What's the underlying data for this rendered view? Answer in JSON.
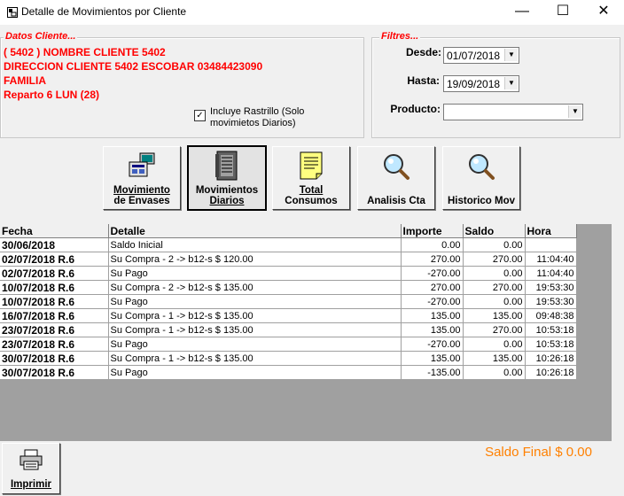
{
  "window": {
    "title": "Detalle de Movimientos por Cliente",
    "controls": {
      "minimize": "—",
      "maximize": "☐",
      "close": "✕"
    }
  },
  "client": {
    "legend": "Datos Cliente...",
    "lines": [
      "( 5402 ) NOMBRE CLIENTE 5402",
      "DIRECCION CLIENTE 5402 ESCOBAR 03484423090",
      "FAMILIA",
      "Reparto 6 LUN (28)"
    ],
    "checkbox_label": "Incluye Rastrillo (Solo movimietos Diarios)",
    "checkbox_checked": true
  },
  "filters": {
    "legend": "Filtres...",
    "desde_label": "Desde:",
    "desde_value": "01/07/2018",
    "hasta_label": "Hasta:",
    "hasta_value": "19/09/2018",
    "producto_label": "Producto:",
    "producto_value": ""
  },
  "toolbar": [
    {
      "line1": "Movimiento",
      "line2": "de Envases",
      "icon": "computer-icon"
    },
    {
      "line1": "Movimientos",
      "line2": "Diarios",
      "icon": "notebook-icon"
    },
    {
      "line1": "Total",
      "line2": "Consumos",
      "icon": "notepad-icon"
    },
    {
      "line1": "Analisis Cta",
      "line2": "",
      "icon": "magnifier-icon"
    },
    {
      "line1": "Historico Mov",
      "line2": "",
      "icon": "magnifier-icon"
    }
  ],
  "table": {
    "columns": [
      "Fecha",
      "Detalle",
      "Importe",
      "Saldo",
      "Hora"
    ],
    "rows": [
      [
        "30/06/2018",
        "Saldo Inicial",
        "0.00",
        "0.00",
        ""
      ],
      [
        "02/07/2018  R.6",
        "Su Compra -  2 -> b12-s $ 120.00",
        "270.00",
        "270.00",
        "11:04:40"
      ],
      [
        "02/07/2018  R.6",
        "Su Pago",
        "-270.00",
        "0.00",
        "11:04:40"
      ],
      [
        "10/07/2018  R.6",
        "Su Compra -  2 -> b12-s $ 135.00",
        "270.00",
        "270.00",
        "19:53:30"
      ],
      [
        "10/07/2018  R.6",
        "Su Pago",
        "-270.00",
        "0.00",
        "19:53:30"
      ],
      [
        "16/07/2018  R.6",
        "Su Compra -  1 -> b12-s $ 135.00",
        "135.00",
        "135.00",
        "09:48:38"
      ],
      [
        "23/07/2018  R.6",
        "Su Compra -  1 -> b12-s $ 135.00",
        "135.00",
        "270.00",
        "10:53:18"
      ],
      [
        "23/07/2018  R.6",
        "Su Pago",
        "-270.00",
        "0.00",
        "10:53:18"
      ],
      [
        "30/07/2018  R.6",
        "Su Compra -  1 -> b12-s $ 135.00",
        "135.00",
        "135.00",
        "10:26:18"
      ],
      [
        "30/07/2018  R.6",
        "Su Pago",
        "-135.00",
        "0.00",
        "10:26:18"
      ]
    ]
  },
  "saldo_final": "Saldo Final $ 0.00",
  "print_button": "Imprimir",
  "colors": {
    "client_text": "#ff0000",
    "saldo": "#ff8000",
    "grid_bg": "#a0a0a0"
  }
}
